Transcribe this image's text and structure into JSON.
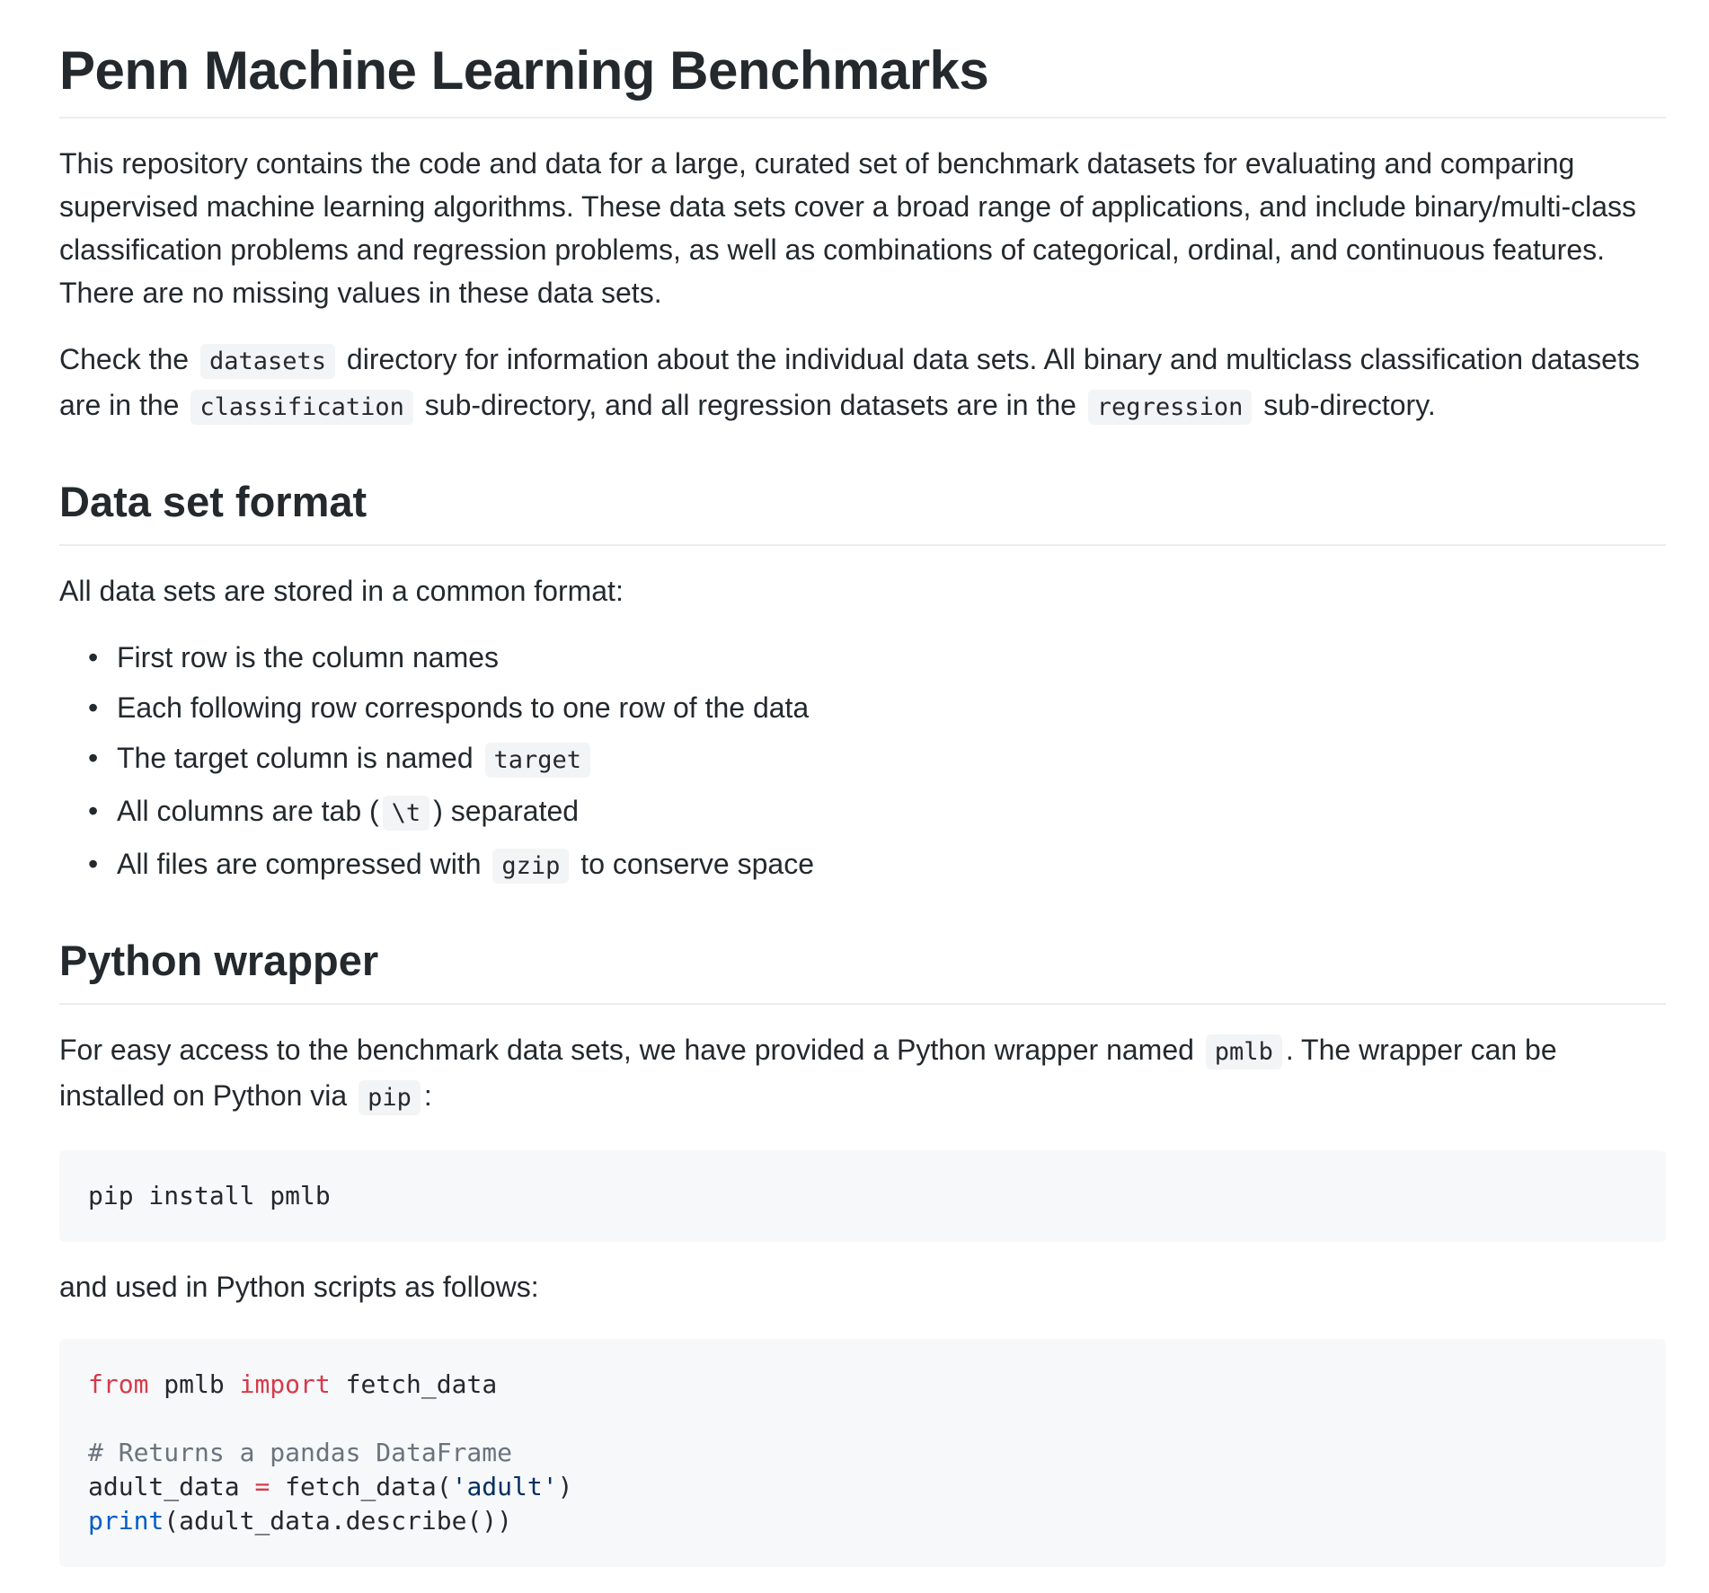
{
  "title": "Penn Machine Learning Benchmarks",
  "intro": {
    "p1": "This repository contains the code and data for a large, curated set of benchmark datasets for evaluating and comparing supervised machine learning algorithms. These data sets cover a broad range of applications, and include binary/multi-class classification problems and regression problems, as well as combinations of categorical, ordinal, and continuous features. There are no missing values in these data sets.",
    "p2": {
      "t1": "Check the",
      "c1": "datasets",
      "t2": "directory for information about the individual data sets. All binary and multiclass classification datasets are in the",
      "c2": "classification",
      "t3": "sub-directory, and all regression datasets are in the",
      "c3": "regression",
      "t4": "sub-directory."
    }
  },
  "format": {
    "heading": "Data set format",
    "lead": "All data sets are stored in a common format:",
    "bullet": "•",
    "items": {
      "i1": "First row is the column names",
      "i2": "Each following row corresponds to one row of the data",
      "i3_text": "The target column is named",
      "i3_code": "target",
      "i4_pre": "All columns are tab (",
      "i4_code": "\\t",
      "i4_post": ") separated",
      "i5_pre": "All files are compressed with",
      "i5_code": "gzip",
      "i5_post": "to conserve space"
    }
  },
  "python": {
    "heading": "Python wrapper",
    "p1_pre": "For easy access to the benchmark data sets, we have provided a Python wrapper named",
    "p1_code": "pmlb",
    "p1_mid": ". The wrapper can be installed on Python via",
    "p1_code2": "pip",
    "p1_end": ":",
    "install_cmd": "pip install pmlb",
    "p2": "and used in Python scripts as follows:",
    "code": {
      "l1_kw1": "from",
      "l1_mod": " pmlb ",
      "l1_kw2": "import",
      "l1_fn": " fetch_data",
      "l3_comment": "# Returns a pandas DataFrame",
      "l4_var": "adult_data ",
      "l4_op": "=",
      "l4_call": " fetch_data(",
      "l4_str": "'adult'",
      "l4_close": ")",
      "l5_builtin": "print",
      "l5_rest": "(adult_data.describe())"
    }
  }
}
